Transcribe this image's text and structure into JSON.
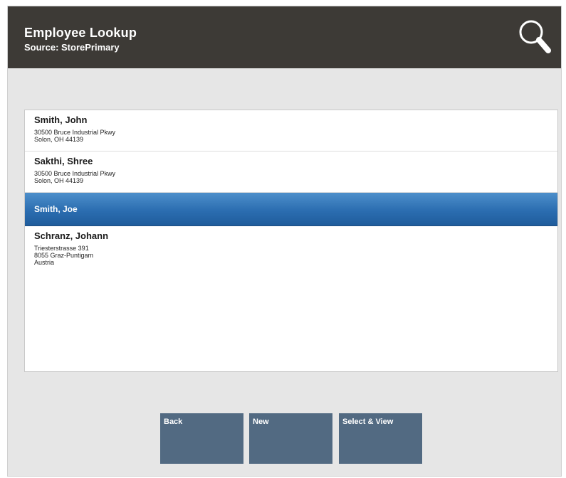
{
  "header": {
    "title": "Employee Lookup",
    "subtitle": "Source: StorePrimary",
    "search_icon": "search-icon",
    "background_color": "#3d3a36"
  },
  "results": [
    {
      "name": "Smith, John",
      "address_lines": [
        "30500 Bruce Industrial Pkwy",
        "Solon, OH 44139"
      ],
      "selected": false
    },
    {
      "name": "Sakthi, Shree",
      "address_lines": [
        "30500 Bruce Industrial Pkwy",
        "Solon, OH 44139"
      ],
      "selected": false
    },
    {
      "name": "Smith, Joe",
      "address_lines": [],
      "selected": true
    },
    {
      "name": "Schranz, Johann",
      "address_lines": [
        "Triesterstrasse 391",
        "8055 Graz-Puntigam",
        "Austria"
      ],
      "selected": false
    }
  ],
  "buttons": {
    "back_label": "Back",
    "new_label": "New",
    "select_view_label": "Select & View"
  },
  "colors": {
    "selection": "#2b6db0",
    "button": "#526a82",
    "background": "#e6e6e6"
  }
}
